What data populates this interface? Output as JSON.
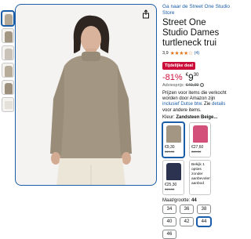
{
  "store_link": "Ga naar de Street One Studio Store",
  "title": "Street One Studio Dames turtleneck trui",
  "rating": {
    "value": "3,9",
    "stars": "★★★★☆",
    "count": "(4)"
  },
  "deal_badge": "Tijdelijke deal",
  "price": {
    "discount": "-81%",
    "symbol": "€",
    "whole": "9",
    "fraction": "30"
  },
  "list_price": {
    "label": "Adviesprijs:",
    "value": "€49,99",
    "info_icon": "info-icon"
  },
  "return_text": {
    "pre": "Prijzen voor items die verkocht worden door Amazon zijn ",
    "link1": "inclusief Dutse btw",
    "mid": ". Zie ",
    "link2": "details",
    "post": " voor andere items."
  },
  "color": {
    "label": "Kleur:",
    "value": "Zandsteen Beige..."
  },
  "swatches": [
    {
      "color": "#a39784",
      "price": "€9,30",
      "list": "€49,99",
      "selected": true
    },
    {
      "color": "#d2507a",
      "price": "€27,60",
      "list": "€49,99",
      "selected": false
    },
    {
      "color": "#2b3350",
      "price": "€25,30",
      "list": "€49,99",
      "selected": false
    },
    {
      "unavailable": "Bekijk 1 opties zonder aanbevolen aanbod"
    }
  ],
  "size": {
    "label": "Maat/grootte:",
    "value": "44"
  },
  "sizes": [
    {
      "label": "34",
      "selected": false
    },
    {
      "label": "36",
      "selected": false
    },
    {
      "label": "38",
      "selected": false
    },
    {
      "label": "40",
      "selected": false
    },
    {
      "label": "42",
      "selected": false
    },
    {
      "label": "44",
      "selected": true
    },
    {
      "label": "46",
      "selected": false
    }
  ],
  "thumbnails": [
    "#b3a895",
    "#a39784",
    "#c8c2b8",
    "#b7ac9a",
    "#9c8f7c",
    "#e4e0da"
  ],
  "colors": {
    "accent": "#1a5da8",
    "deal": "#cc0c39",
    "star": "#de7921"
  }
}
